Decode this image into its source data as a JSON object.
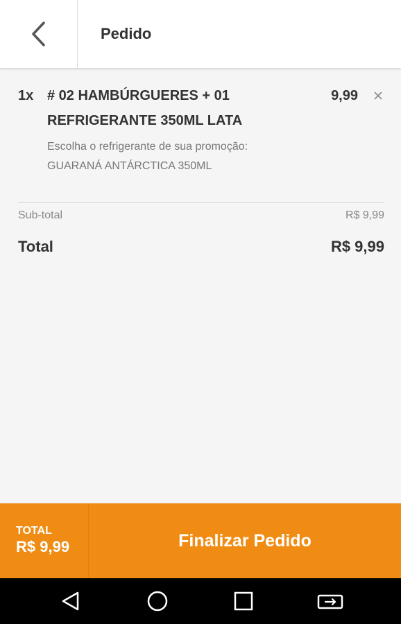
{
  "header": {
    "title": "Pedido",
    "back_icon": "chevron-left-icon"
  },
  "order": {
    "items": [
      {
        "quantity": "1x",
        "name": "# 02 HAMBÚRGUERES + 01 REFRIGERANTE 350ML LATA",
        "option_label": "Escolha o refrigerante de sua promoção:",
        "option_value": "GUARANÁ ANTÁRCTICA 350ML",
        "price": "9,99",
        "remove_icon": "close-icon"
      }
    ],
    "subtotal_label": "Sub-total",
    "subtotal_value": "R$ 9,99",
    "total_label": "Total",
    "total_value": "R$ 9,99"
  },
  "footer": {
    "total_label": "TOTAL",
    "total_value": "R$ 9,99",
    "finish_label": "Finalizar Pedido"
  },
  "navbar": {
    "icons": [
      "back-triangle-icon",
      "home-circle-icon",
      "recents-square-icon",
      "switch-app-icon"
    ]
  },
  "colors": {
    "accent": "#f08c13",
    "header_bg": "#ffffff",
    "page_bg": "#f5f5f5"
  }
}
